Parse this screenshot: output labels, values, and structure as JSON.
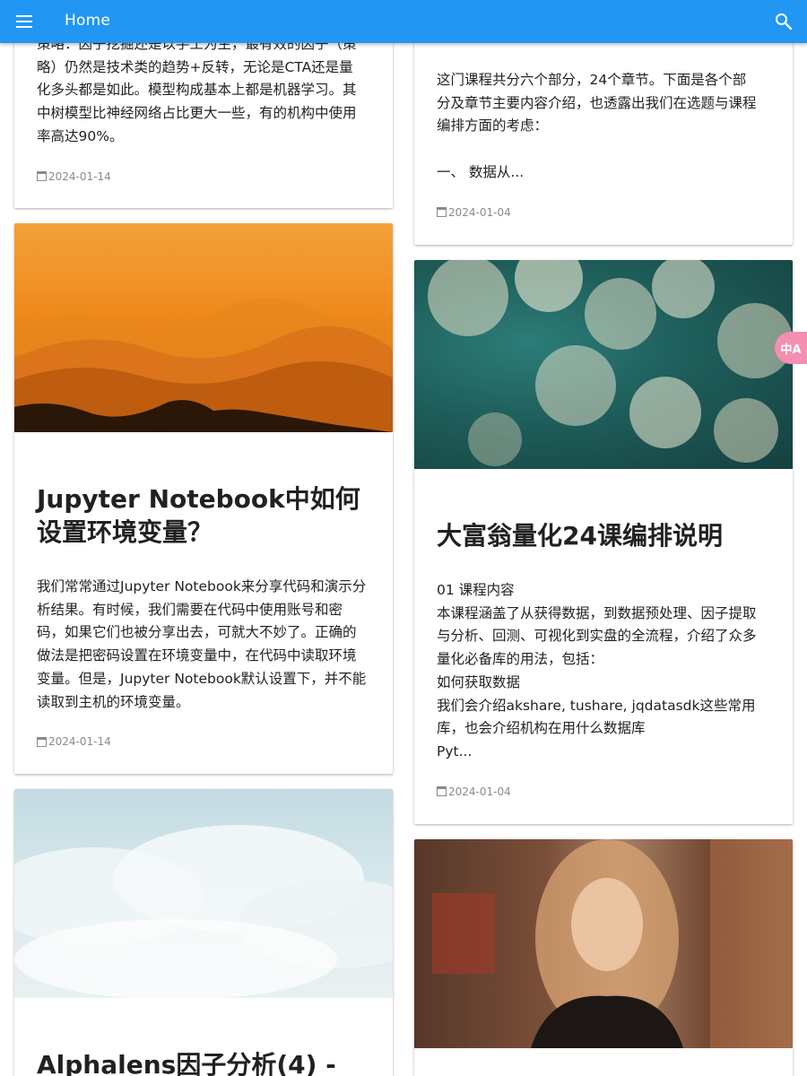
{
  "appbar": {
    "title": "Home",
    "menu_icon": "menu-icon",
    "search_icon": "search-icon",
    "color": "#2196f3"
  },
  "side_float": {
    "label": "中A",
    "icon": "translate-icon",
    "color": "#f48fb1"
  },
  "left_column": [
    {
      "summary_lines": [
        "策略：因子挖掘还是以手工为主，最有效的因子（策",
        "略）仍然是技术类的趋势+反转，无论是CTA还是量",
        "化多头都是如此。模型构成基本上都是机器学习。其",
        "中树模型比神经网络占比更大一些，有的机构中使用",
        "率高达90%。"
      ],
      "date": "2024-01-14"
    },
    {
      "title": "Jupyter Notebook中如何设置环境变量？",
      "summary_lines": [
        "我们常常通过Jupyter Notebook来分享代码和演示分",
        "析结果。有时候，我们需要在代码中使用账号和密",
        "码，如果它们也被分享出去，可就大不妙了。正确的",
        "做法是把密码设置在环境变量中，在代码中读取环境",
        "变量。但是，Jupyter Notebook默认设置下，并不能",
        "读取到主机的环境变量。"
      ],
      "date": "2024-01-14"
    },
    {
      "title": "Alphalens因子分析(4) -"
    }
  ],
  "right_column": [
    {
      "summary_lines": [
        "这门课程共分六个部分，24个章节。下面是各个部",
        "分及章节主要内容介绍，也透露出我们在选题与课程",
        "编排方面的考虑：",
        "",
        "一、 数据从..."
      ],
      "date": "2024-01-04"
    },
    {
      "title": "大富翁量化24课编排说明",
      "summary_lines": [
        "01 课程内容",
        "本课程涵盖了从获得数据，到数据预处理、因子提取",
        "与分析、回测、可视化到实盘的全流程，介绍了众多",
        "量化必备库的用法，包括：",
        "如何获取数据",
        "我们会介绍akshare, tushare, jqdatasdk这些常用",
        "库，也会介绍机构在用什么数据库",
        "Pyt..."
      ],
      "date": "2024-01-04"
    }
  ]
}
